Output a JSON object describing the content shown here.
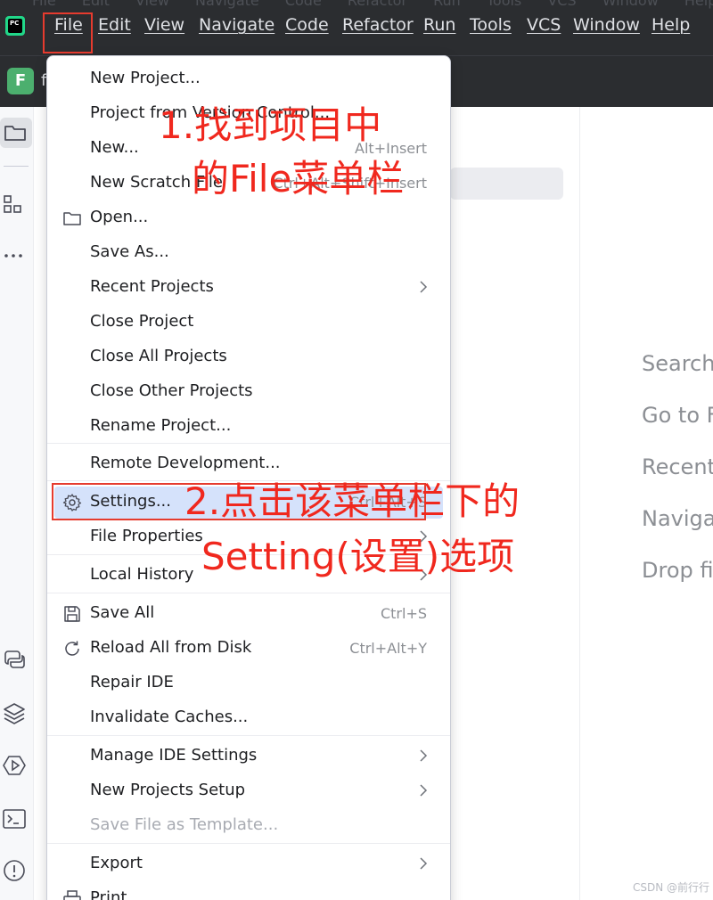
{
  "menubar": {
    "logo_text": "PC",
    "ghost_row": "File Edit View Navigate Code Refactor Run Tools VCS Window Help",
    "items": [
      "File",
      "Edit",
      "View",
      "Navigate",
      "Code",
      "Refactor",
      "Run",
      "Tools",
      "VCS",
      "Window",
      "Help"
    ]
  },
  "toolbar": {
    "project_badge": "F",
    "project_name": "f"
  },
  "file_menu": {
    "new_project": "New Project...",
    "project_from_vcs": "Project from Version Control...",
    "new": "New...",
    "new_shortcut": "Alt+Insert",
    "new_scratch": "New Scratch File",
    "new_scratch_shortcut": "Ctrl+Alt+Shift+Insert",
    "open": "Open...",
    "save_as": "Save As...",
    "recent_projects": "Recent Projects",
    "close_project": "Close Project",
    "close_all_projects": "Close All Projects",
    "close_other_projects": "Close Other Projects",
    "rename_project": "Rename Project...",
    "remote_development": "Remote Development...",
    "settings": "Settings...",
    "settings_shortcut": "Ctrl+Alt+S",
    "file_properties": "File Properties",
    "local_history": "Local History",
    "save_all": "Save All",
    "save_all_shortcut": "Ctrl+S",
    "reload_all": "Reload All from Disk",
    "reload_all_shortcut": "Ctrl+Alt+Y",
    "repair_ide": "Repair IDE",
    "invalidate_caches": "Invalidate Caches...",
    "manage_ide_settings": "Manage IDE Settings",
    "new_projects_setup": "New Projects Setup",
    "save_file_as_template": "Save File as Template...",
    "export": "Export",
    "print": "Print"
  },
  "welcome_hints": [
    "Search",
    "Go to F",
    "Recent",
    "Naviga",
    "Drop fil"
  ],
  "annotations": {
    "step1_line1": "1.找到项目中",
    "step1_line2": "的File菜单栏",
    "step2_line1": "2.点击该菜单栏下的",
    "step2_line2": "Setting(设置)选项",
    "color": "#f0281e"
  },
  "watermark": "CSDN @前行行",
  "colors": {
    "menubar_bg": "#2b2d30",
    "selected_bg": "#d5e2fb",
    "accent_red": "#e63b2e"
  }
}
